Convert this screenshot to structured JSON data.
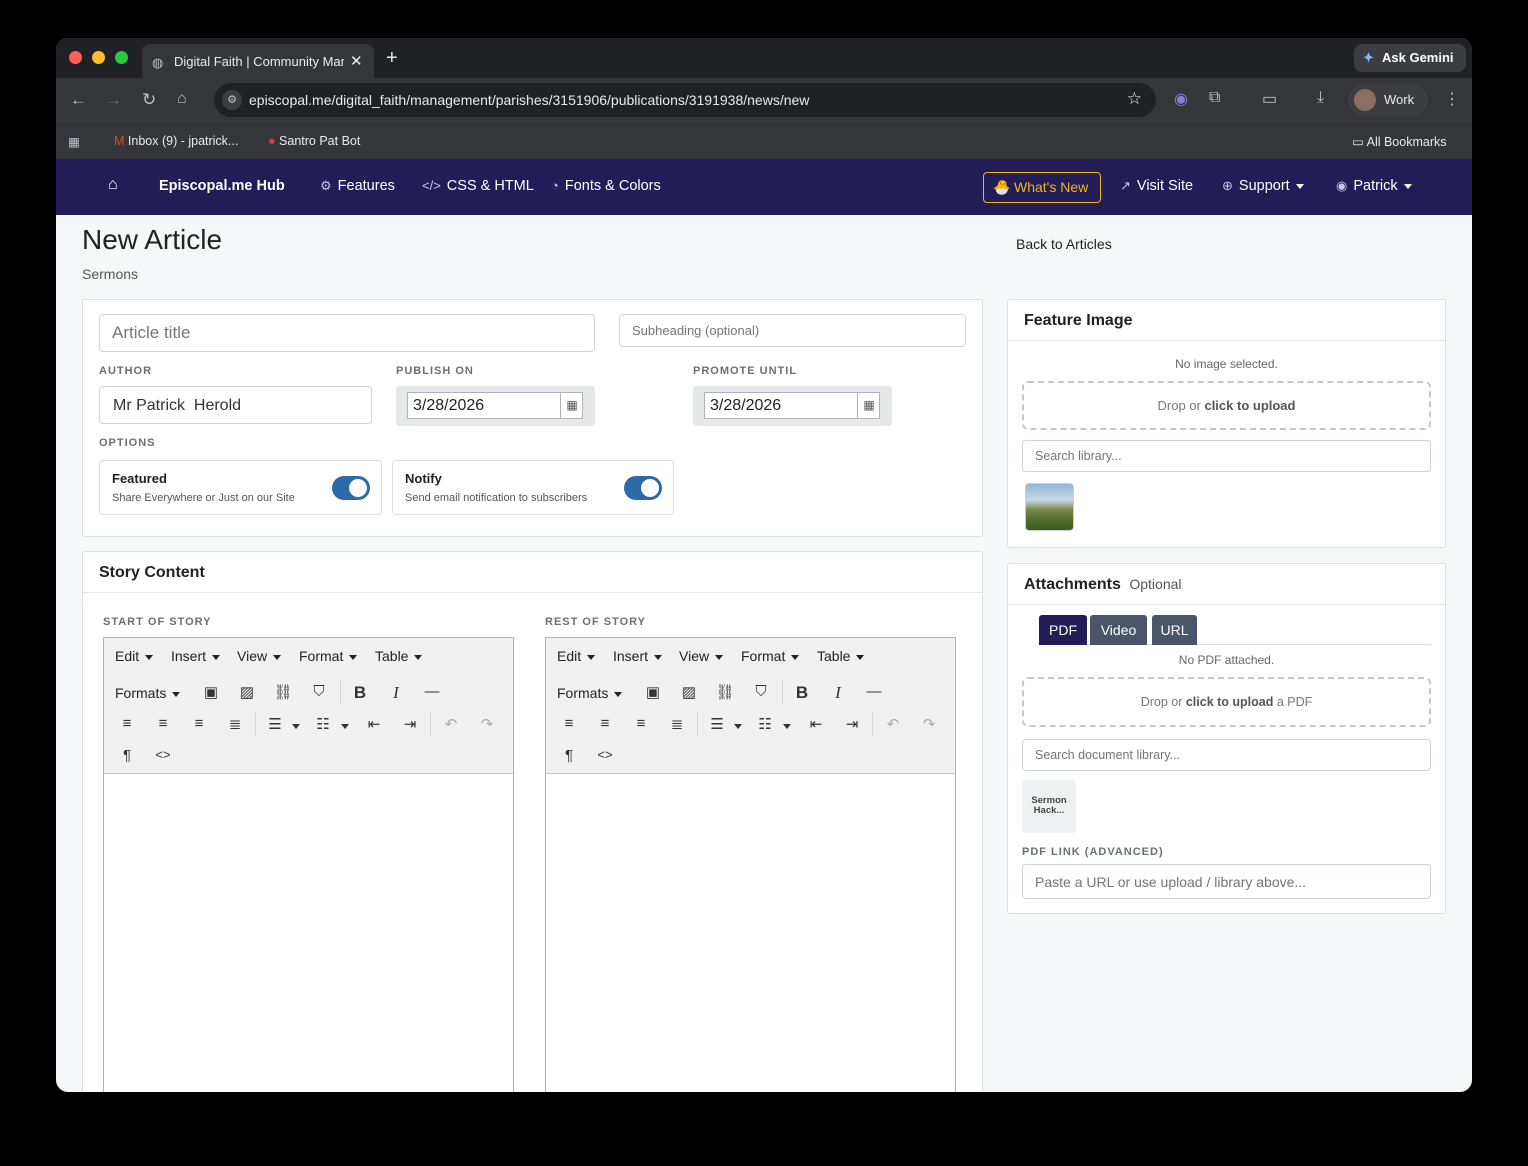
{
  "browser": {
    "tab_title": "Digital Faith | Community Management",
    "ask_gemini": "Ask Gemini",
    "url_host": "episcopal.me",
    "url_path": "/digital_faith/management/parishes/3151906/publications/3191938/news/new",
    "profile": "Work",
    "bookmarks": [
      {
        "label": "Inbox (9) - jpatrick..."
      },
      {
        "label": "Santro Pat Bot"
      }
    ],
    "all_bookmarks": "All Bookmarks"
  },
  "site_nav": {
    "brand": "Episcopal.me Hub",
    "items": [
      "Features",
      "CSS & HTML",
      "Fonts & Colors"
    ],
    "whats_new": "What's New",
    "visit_site": "Visit Site",
    "support": "Support",
    "user": "Patrick"
  },
  "page": {
    "title": "New Article",
    "subtitle": "Sermons",
    "back_link": "Back to Articles"
  },
  "form": {
    "title_placeholder": "Article title",
    "subheading_placeholder": "Subheading (optional)",
    "author_label": "AUTHOR",
    "author_value": "Mr Patrick  Herold",
    "publish_label": "PUBLISH ON",
    "publish_value": "3/28/2026",
    "promote_label": "PROMOTE UNTIL",
    "promote_value": "3/28/2026",
    "options_label": "OPTIONS",
    "featured": {
      "title": "Featured",
      "desc": "Share Everywhere or Just on our Site",
      "on": true
    },
    "notify": {
      "title": "Notify",
      "desc": "Send email notification to subscribers",
      "on": true
    }
  },
  "story": {
    "heading": "Story Content",
    "start_label": "START OF STORY",
    "rest_label": "REST OF STORY",
    "menus": [
      "Edit",
      "Insert",
      "View",
      "Format",
      "Table"
    ],
    "formats": "Formats"
  },
  "feature_image": {
    "heading": "Feature Image",
    "status": "No image selected.",
    "drop_prefix": "Drop or ",
    "drop_link": "click to upload",
    "search_placeholder": "Search library..."
  },
  "attachments": {
    "heading": "Attachments",
    "optional": "Optional",
    "tabs": [
      "PDF",
      "Video",
      "URL"
    ],
    "status": "No PDF attached.",
    "drop_prefix": "Drop or ",
    "drop_link": "click to upload",
    "drop_suffix": " a PDF",
    "search_placeholder": "Search document library...",
    "doc_thumb": "Sermon Hack...",
    "pdf_link_label": "PDF LINK (ADVANCED)",
    "pdf_link_placeholder": "Paste a URL or use upload / library above..."
  },
  "colors": {
    "nav_bg": "#231d57",
    "accent": "#f0b429",
    "toggle": "#2c6aa8",
    "pdf_tab": "#231d57",
    "tab_inactive": "#4a5568"
  }
}
